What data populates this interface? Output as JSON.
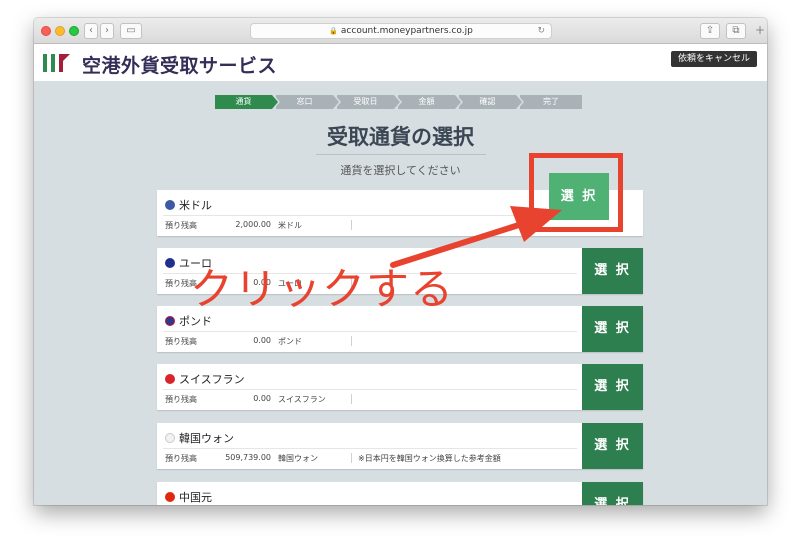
{
  "browser": {
    "url": "account.moneypartners.co.jp"
  },
  "header": {
    "logo_text": "空港外貨受取サービス",
    "cancel_label": "依頼をキャンセル"
  },
  "steps": [
    {
      "label": "通貨",
      "active": true
    },
    {
      "label": "窓口",
      "active": false
    },
    {
      "label": "受取日",
      "active": false
    },
    {
      "label": "金額",
      "active": false
    },
    {
      "label": "確認",
      "active": false
    },
    {
      "label": "完了",
      "active": false
    }
  ],
  "page": {
    "title": "受取通貨の選択",
    "subtitle": "通貨を選択してください"
  },
  "balance_label": "預り残高",
  "select_label": "選 択",
  "currencies": [
    {
      "name": "米ドル",
      "balance": "2,000.00",
      "unit": "米ドル",
      "note": "",
      "flag_color": "#3c5aa6"
    },
    {
      "name": "ユーロ",
      "balance": "0.00",
      "unit": "ユーロ",
      "note": "",
      "flag_color": "#1f2f8f"
    },
    {
      "name": "ポンド",
      "balance": "0.00",
      "unit": "ポンド",
      "note": "",
      "flag_color": "#2a3b8f"
    },
    {
      "name": "スイスフラン",
      "balance": "0.00",
      "unit": "スイスフラン",
      "note": "",
      "flag_color": "#d8242b"
    },
    {
      "name": "韓国ウォン",
      "balance": "509,739.00",
      "unit": "韓国ウォン",
      "note": "※日本円を韓国ウォン換算した参考金額",
      "flag_color": "#f2f2f2"
    },
    {
      "name": "中国元",
      "balance": "",
      "unit": "",
      "note": "",
      "flag_color": "#de2910"
    }
  ],
  "annotation": {
    "text": "クリックする",
    "color": "#e8432f"
  }
}
